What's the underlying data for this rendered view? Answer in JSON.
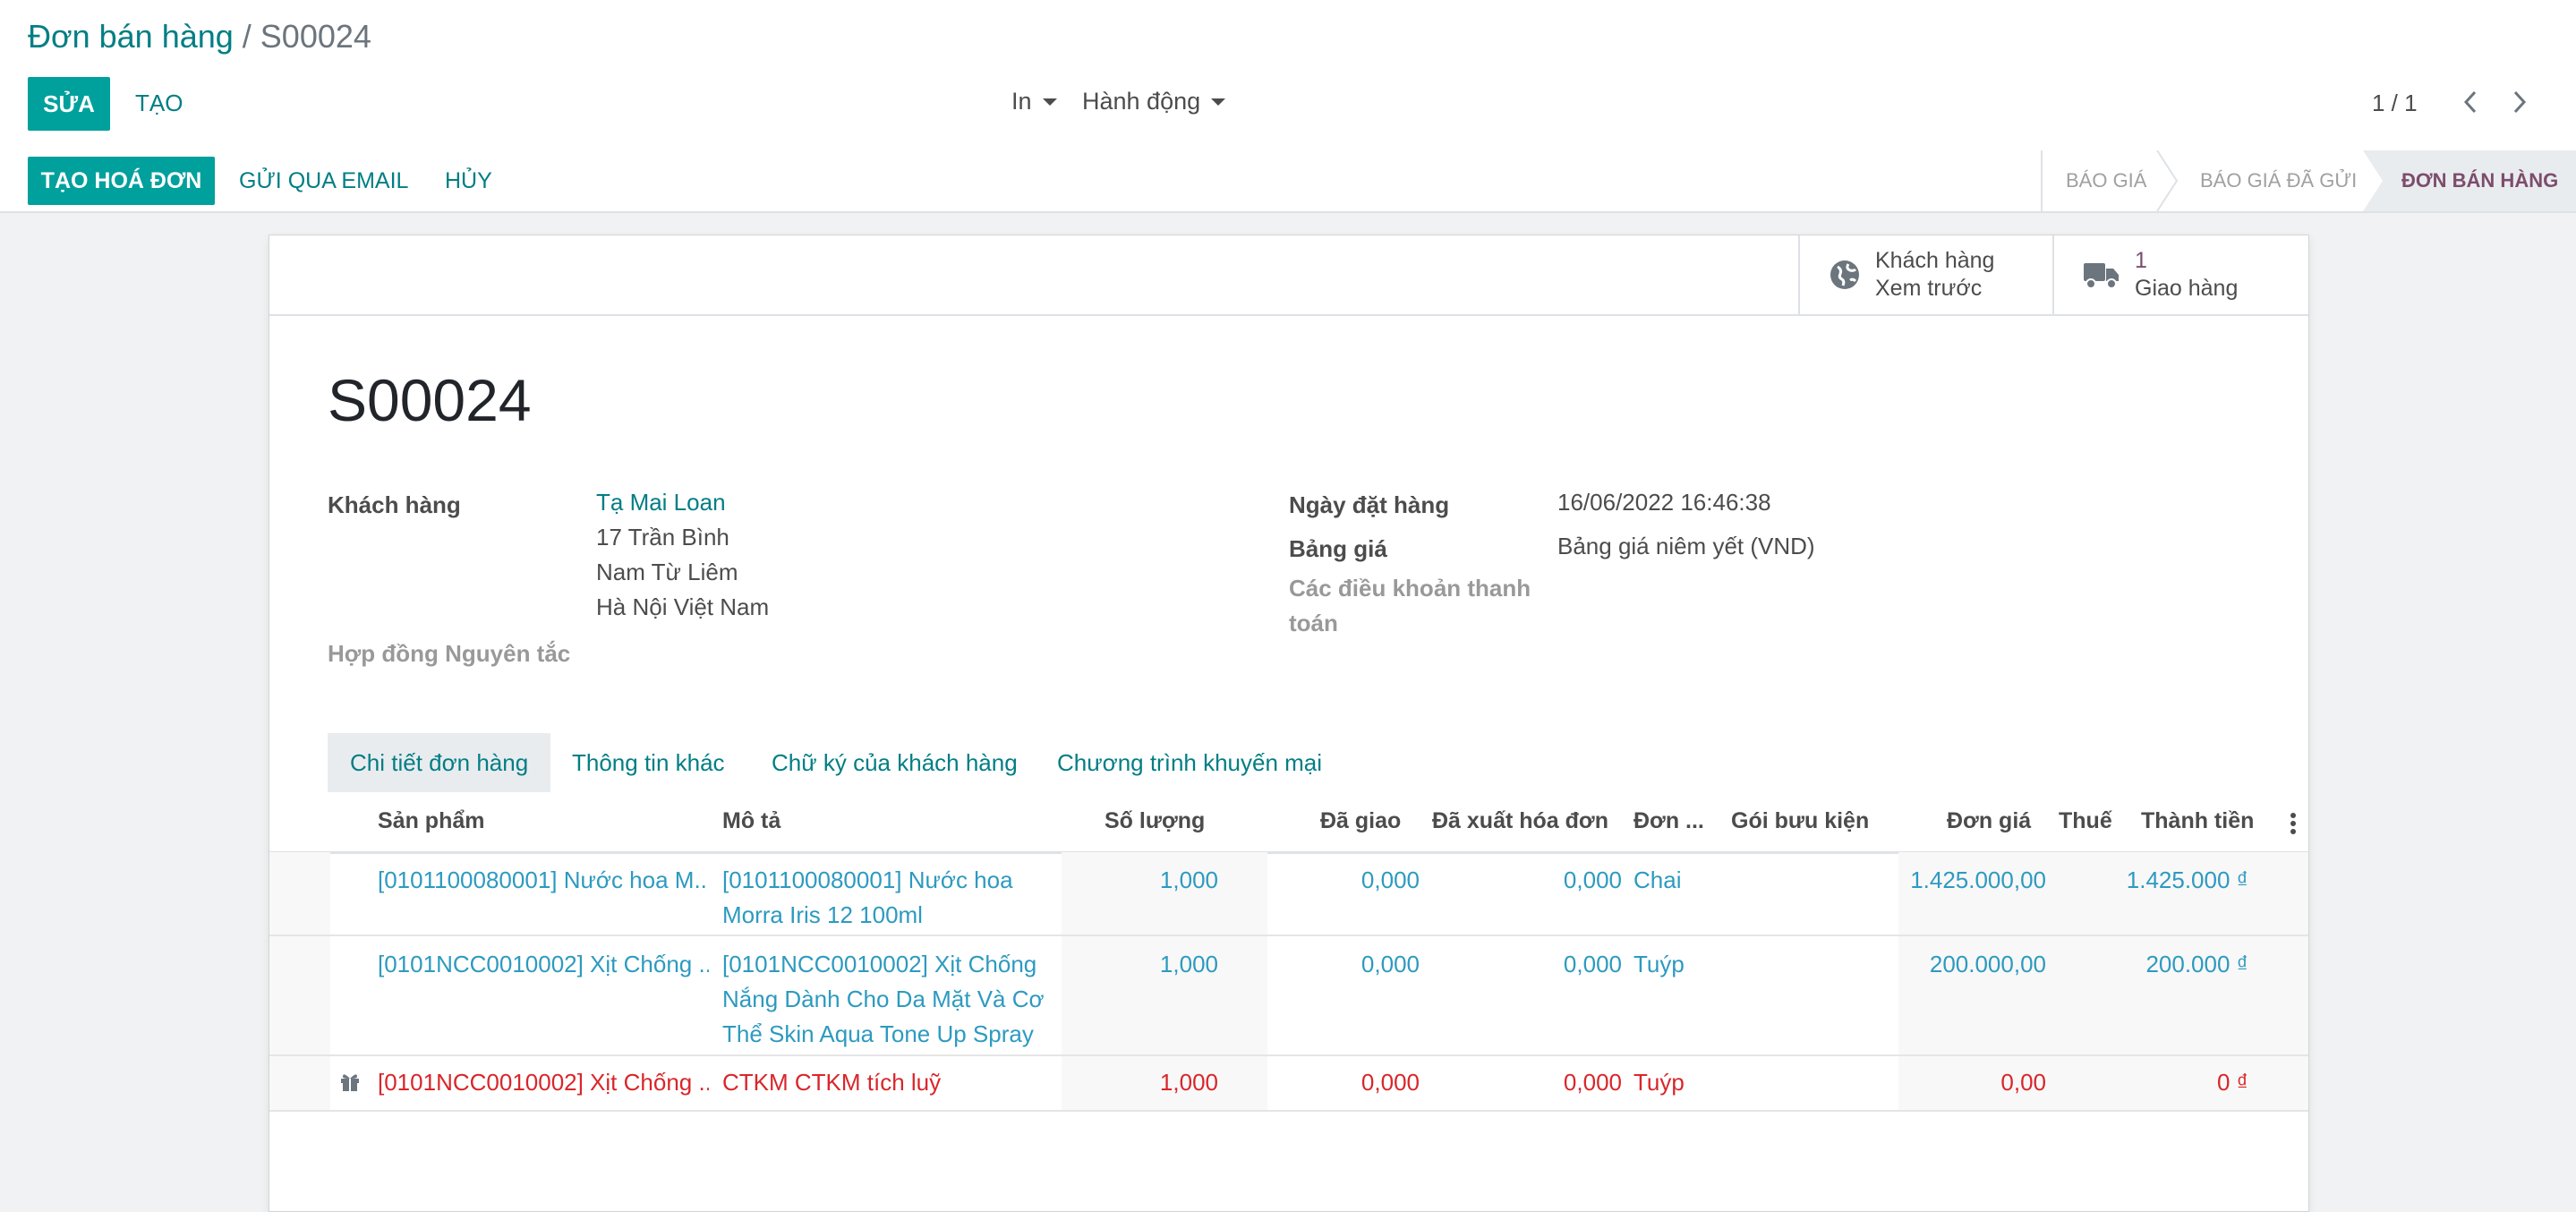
{
  "breadcrumb": {
    "parent": "Đơn bán hàng",
    "sep": "/",
    "current": "S00024"
  },
  "toolbar": {
    "edit_label": "SỬA",
    "create_label": "TẠO",
    "print_label": "In",
    "action_label": "Hành động",
    "pager": "1 / 1"
  },
  "statusbar": {
    "invoice_label": "TẠO HOÁ ĐƠN",
    "email_label": "GỬI QUA EMAIL",
    "cancel_label": "HỦY",
    "stages": [
      "BÁO GIÁ",
      "BÁO GIÁ ĐÃ GỬI",
      "ĐƠN BÁN HÀNG"
    ],
    "active_stage": "ĐƠN BÁN HÀNG"
  },
  "smart_buttons": {
    "customer_line1": "Khách hàng",
    "customer_line2": "Xem trước",
    "delivery_count": "1",
    "delivery_label": "Giao hàng"
  },
  "order": {
    "name": "S00024",
    "customer_label": "Khách hàng",
    "customer_name": "Tạ Mai Loan",
    "address": [
      "17 Trần Bình",
      "Nam Từ Liêm",
      "Hà Nội Việt Nam"
    ],
    "contract_label": "Hợp đồng Nguyên tắc",
    "date_label": "Ngày đặt hàng",
    "date_value": "16/06/2022 16:46:38",
    "pricelist_label": "Bảng giá",
    "pricelist_value": "Bảng giá niêm yết (VND)",
    "terms_label": "Các điều khoản thanh toán"
  },
  "tabs": [
    "Chi tiết đơn hàng",
    "Thông tin khác",
    "Chữ ký của khách hàng",
    "Chương trình khuyến mại"
  ],
  "table": {
    "headers": [
      "Sản phẩm",
      "Mô tả",
      "Số lượng",
      "Đã giao",
      "Đã xuất hóa đơn",
      "Đơn ...",
      "Gói bưu kiện",
      "Đơn giá",
      "Thuế",
      "Thành tiền"
    ],
    "rows": [
      {
        "product": "[0101100080001] Nước hoa M...",
        "desc": "[0101100080001] Nước hoa Morra Iris 12 100ml",
        "qty": "1,000",
        "delivered": "0,000",
        "invoiced": "0,000",
        "uom": "Chai",
        "price": "1.425.000,00",
        "subtotal": "1.425.000 ₫"
      },
      {
        "product": "[0101NCC0010002] Xịt Chống ...",
        "desc": "[0101NCC0010002] Xịt Chống Nắng Dành Cho Da Mặt Và Cơ Thể Skin Aqua Tone Up Spray",
        "qty": "1,000",
        "delivered": "0,000",
        "invoiced": "0,000",
        "uom": "Tuýp",
        "price": "200.000,00",
        "subtotal": "200.000 ₫"
      },
      {
        "product": "[0101NCC0010002] Xịt Chống ...",
        "desc": "CTKM CTKM tích luỹ",
        "qty": "1,000",
        "delivered": "0,000",
        "invoiced": "0,000",
        "uom": "Tuýp",
        "price": "0,00",
        "subtotal": "0 ₫"
      }
    ]
  },
  "colors": {
    "accent": "#00a09d",
    "link": "#017e84",
    "line_link": "#2d9ac0",
    "reward": "#d9262a"
  }
}
